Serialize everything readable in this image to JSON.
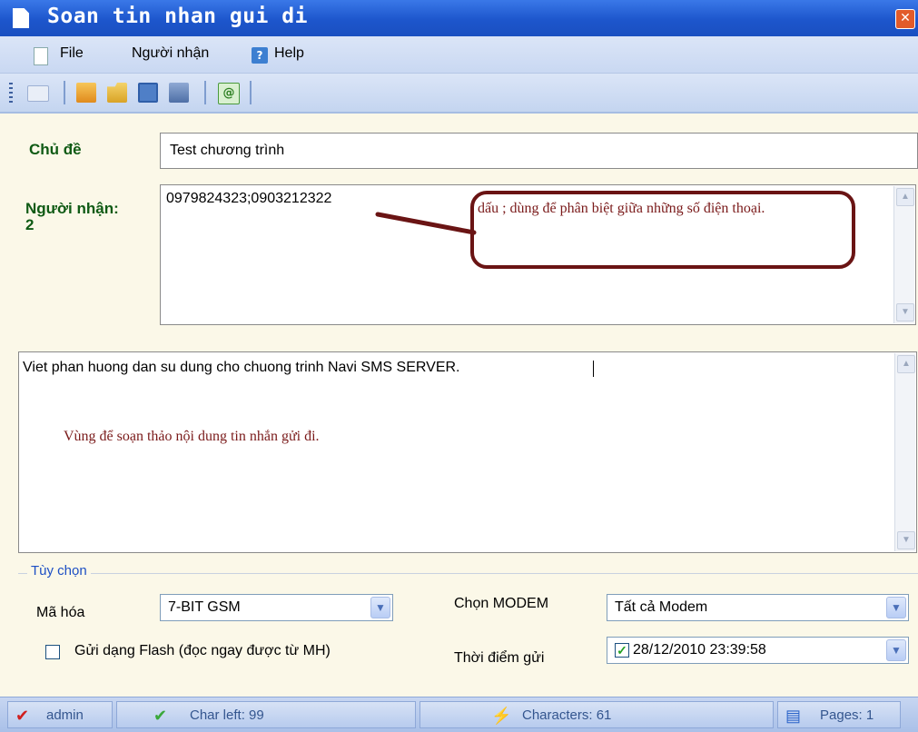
{
  "window": {
    "title": "Soan tin nhan gui di",
    "close_icon": "close-icon"
  },
  "menu": {
    "items": [
      "File",
      "Người nhận",
      "Help"
    ]
  },
  "toolbar": {
    "icons": [
      "new-message-icon",
      "compose-icon",
      "open-folder-icon",
      "save-icon",
      "copy-icon",
      "email-icon"
    ]
  },
  "subject": {
    "label": "Chủ đề",
    "value": "Test chương trình"
  },
  "recipients": {
    "label": "Người nhận:",
    "count": "2",
    "value": "0979824323;0903212322",
    "annotation": "dấu ; dùng để phân biệt giữa những số điện thoại."
  },
  "body": {
    "value": "Viet phan huong dan su dung cho chuong trinh Navi SMS SERVER.",
    "annotation": "Vùng  để soạn thảo nội dung tin nhắn gửi đi."
  },
  "options": {
    "group_title": "Tùy chọn",
    "encoding_label": "Mã hóa",
    "encoding_value": "7-BIT GSM",
    "flash_label": "Gửi dạng Flash (đọc ngay được từ MH)",
    "flash_checked": false,
    "modem_label": "Chọn MODEM",
    "modem_value": "Tất cả Modem",
    "send_time_label": "Thời điểm gửi",
    "send_time_value": "28/12/2010 23:39:58",
    "send_time_checked": true
  },
  "status": {
    "user": "admin",
    "char_left": "Char left: 99",
    "characters": "Characters: 61",
    "pages": "Pages: 1"
  },
  "colors": {
    "title_bar": "#1d56cc",
    "label_green": "#0f5a14",
    "annotation_red": "#7a1a1a",
    "status_text": "#34568f"
  }
}
